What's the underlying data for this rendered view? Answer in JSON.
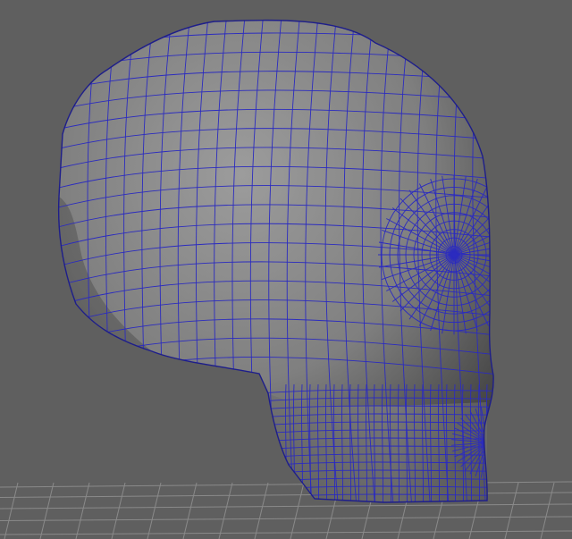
{
  "viewport": {
    "background_color": "#5f5f5f",
    "grid_color": "#8a8a8a",
    "object": {
      "type": "polygon-mesh",
      "subject": "skull",
      "shading": "smooth-gray",
      "base_color": "#8e8e8e",
      "wireframe_color": "#2b2bbf",
      "selected": true
    },
    "floor_grid": {
      "visible": true
    }
  }
}
